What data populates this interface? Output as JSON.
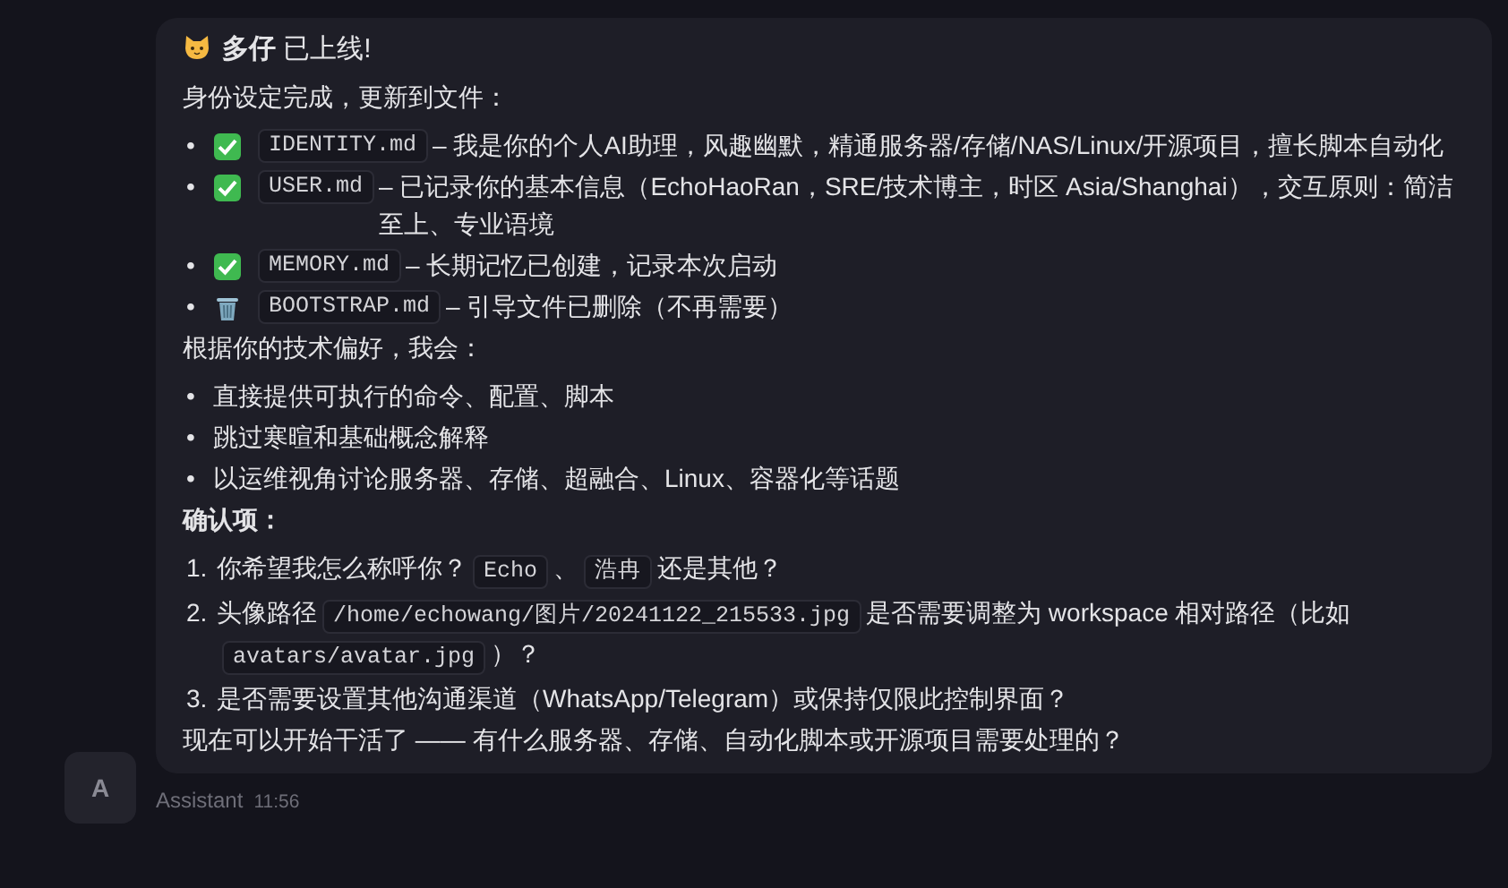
{
  "message": {
    "title": "**多仔** 已上线!",
    "intro": "身份设定完成，更新到文件：",
    "files": [
      {
        "marker": "•",
        "kind": "done",
        "file": "IDENTITY.md",
        "text": "– 我是你的个人AI助理，风趣幽默，精通服务器/存储/NAS/Linux/开源项目，擅长脚本自动化"
      },
      {
        "marker": "•",
        "kind": "done",
        "file": "USER.md",
        "text": "– 已记录你的基本信息（EchoHaoRan，SRE/技术博主，时区 Asia/Shanghai），交互原则：简洁至上、专业语境"
      },
      {
        "marker": "•",
        "kind": "done",
        "file": "MEMORY.md",
        "text": "– 长期记忆已创建，记录本次启动"
      },
      {
        "marker": "•",
        "kind": "deleted",
        "file": "BOOTSTRAP.md",
        "text": "– 引导文件已删除（不再需要）"
      }
    ],
    "prefs_heading": "根据你的技术偏好，我会：",
    "prefs": [
      {
        "marker": "•",
        "text": "直接提供可执行的命令、配置、脚本"
      },
      {
        "marker": "•",
        "text": "跳过寒暄和基础概念解释"
      },
      {
        "marker": "•",
        "text": "以运维视角讨论服务器、存储、超融合、Linux、容器化等话题"
      }
    ],
    "confirm_heading": "确认项：",
    "questions": [
      {
        "marker": "1.",
        "parts": [
          {
            "kind": "text",
            "text": "你希望我怎么称呼你？"
          },
          {
            "kind": "code",
            "text": "Echo"
          },
          {
            "kind": "text",
            "text": "、"
          },
          {
            "kind": "code",
            "text": "浩冉"
          },
          {
            "kind": "text",
            "text": "还是其他？"
          }
        ]
      },
      {
        "marker": "2.",
        "parts": [
          {
            "kind": "text",
            "text": "头像路径"
          },
          {
            "kind": "code",
            "text": "/home/echowang/图片/20241122_215533.jpg"
          },
          {
            "kind": "text",
            "text": "是否需要调整为 workspace 相对路径（比如"
          },
          {
            "kind": "code",
            "text": "avatars/avatar.jpg"
          },
          {
            "kind": "text",
            "text": "）？"
          }
        ]
      },
      {
        "marker": "3.",
        "parts": [
          {
            "kind": "text",
            "text": "是否需要设置其他沟通渠道（WhatsApp/Telegram）或保持仅限此控制界面？"
          }
        ]
      }
    ],
    "closing": "现在可以开始干活了 —— 有什么服务器、存储、自动化脚本或开源项目需要处理的？"
  },
  "avatar": "A",
  "sender": "Assistant",
  "time": "11:56"
}
